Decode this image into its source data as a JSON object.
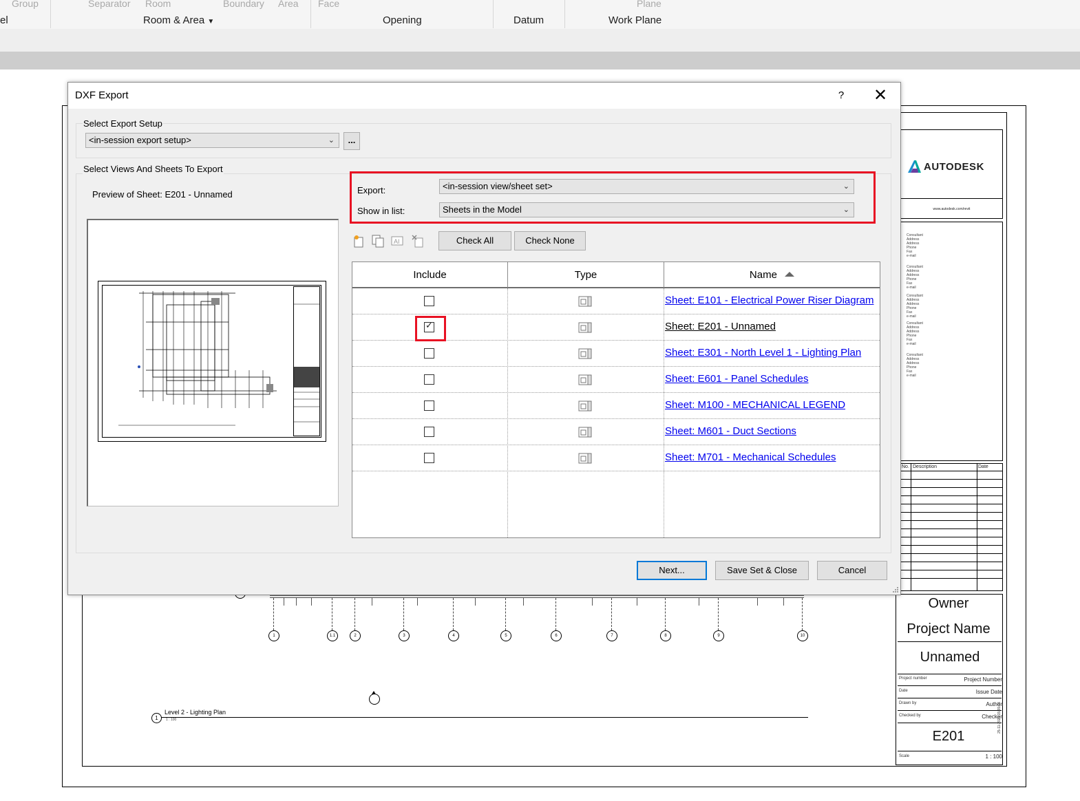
{
  "ribbon": {
    "top_labels": [
      "Group",
      "Separator",
      "Room",
      "Boundary",
      "Area",
      "Face",
      "Plane"
    ],
    "panels": [
      "el",
      "Room & Area",
      "Opening",
      "Datum",
      "Work Plane"
    ]
  },
  "titleblock": {
    "brand": "AUTODESK",
    "website": "www.autodesk.com/revit",
    "consultant_lines": [
      "Consultant",
      "Address",
      "Address",
      "Phone",
      "Fax",
      "e-mail"
    ],
    "rev_headers": [
      "No.",
      "Description",
      "Date"
    ],
    "owner": "Owner",
    "project_name": "Project Name",
    "sheet_name": "Unnamed",
    "rows": [
      {
        "label": "Project number",
        "value": "Project Number"
      },
      {
        "label": "Date",
        "value": "Issue Date"
      },
      {
        "label": "Drawn by",
        "value": "Author"
      },
      {
        "label": "Checked by",
        "value": "Checker"
      }
    ],
    "sheet_number": "E201",
    "scale_label": "Scale",
    "scale_value": "1 : 100",
    "datestamp": "25-11-2023 15:55:06"
  },
  "drawing": {
    "grid_bubbles": [
      "1",
      "1.1",
      "2",
      "3",
      "4",
      "5",
      "6",
      "7",
      "8",
      "9",
      "10"
    ],
    "view_number": "1",
    "view_title": "Level 2 - Lighting Plan",
    "view_scale": "1 : 100"
  },
  "dialog": {
    "title": "DXF Export",
    "help": "?",
    "close": "✕",
    "select_export_setup_label": "Select Export Setup",
    "export_setup_value": "<in-session export setup>",
    "browse_label": "...",
    "select_views_label": "Select Views And Sheets To Export",
    "preview_label": "Preview of Sheet: E201 - Unnamed",
    "export_label": "Export:",
    "export_value": "<in-session view/sheet set>",
    "show_in_list_label": "Show in list:",
    "show_in_list_value": "Sheets in the Model",
    "check_all": "Check All",
    "check_none": "Check None",
    "columns": {
      "include": "Include",
      "type": "Type",
      "name": "Name"
    },
    "rows": [
      {
        "checked": false,
        "name": "Sheet: E101 - Electrical Power Riser Diagram"
      },
      {
        "checked": true,
        "name": "Sheet: E201 - Unnamed"
      },
      {
        "checked": false,
        "name": "Sheet: E301 - North Level 1 - Lighting Plan"
      },
      {
        "checked": false,
        "name": "Sheet: E601 - Panel Schedules"
      },
      {
        "checked": false,
        "name": "Sheet: M100 - MECHANICAL LEGEND"
      },
      {
        "checked": false,
        "name": "Sheet: M601 - Duct Sections"
      },
      {
        "checked": false,
        "name": "Sheet: M701 - Mechanical Schedules"
      }
    ],
    "next": "Next...",
    "save_set_close": "Save Set & Close",
    "cancel": "Cancel"
  }
}
